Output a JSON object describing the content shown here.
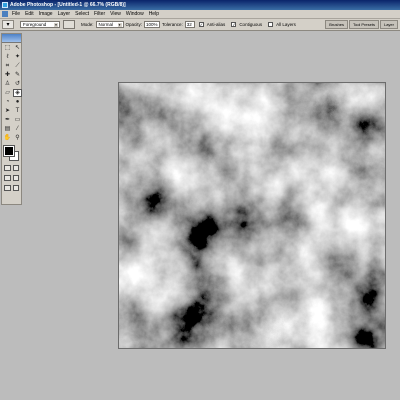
{
  "titlebar": {
    "title": "Adobe Photoshop - [Untitled-1 @ 66.7% (RGB/8)]"
  },
  "menu": [
    "File",
    "Edit",
    "Image",
    "Layer",
    "Select",
    "Filter",
    "View",
    "Window",
    "Help"
  ],
  "options": {
    "tool_icon": "paint-bucket-icon",
    "fill_source": "Foreground",
    "mode_label": "Mode:",
    "mode_value": "Normal",
    "opacity_label": "Opacity:",
    "opacity_value": "100%",
    "tolerance_label": "Tolerance:",
    "tolerance_value": "32",
    "anti_alias_label": "Anti-alias",
    "contiguous_label": "Contiguous",
    "all_layers_label": "All Layers"
  },
  "palette_well": [
    "Brushes",
    "Tool Presets",
    "Layer"
  ],
  "colors": {
    "foreground": "#000000",
    "background": "#ffffff",
    "workspace": "#bcbcbc"
  },
  "document": {
    "content": "clouds-render",
    "palette": "grayscale"
  }
}
